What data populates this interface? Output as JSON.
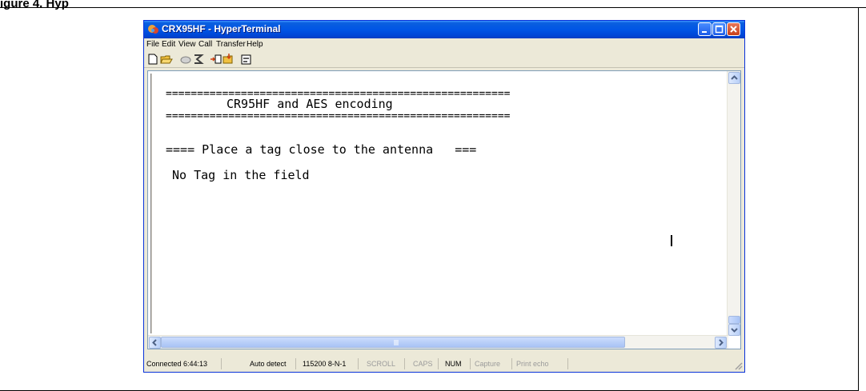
{
  "figure": {
    "caption": "igure 4. Hyp"
  },
  "window": {
    "title": "CRX95HF - HyperTerminal",
    "controls": {
      "minimize": "minimize-icon",
      "maximize": "maximize-icon",
      "close": "close-icon"
    }
  },
  "menu": [
    "File",
    "Edit",
    "View",
    "Call",
    "Transfer",
    "Help"
  ],
  "toolbar": [
    "new-connection-icon",
    "open-icon",
    "disconnect-icon",
    "dial-icon",
    "send-icon",
    "receive-icon",
    "properties-icon"
  ],
  "terminal": {
    "lines": [
      "=======================================================",
      "CR95HF and AES encoding",
      "=======================================================",
      "==== Place a tag close to the antenna   ===",
      "No Tag in the field"
    ]
  },
  "status": {
    "connected": "Connected 6:44:13",
    "detect": "Auto detect",
    "port": "115200 8-N-1",
    "scroll": "SCROLL",
    "caps": "CAPS",
    "num": "NUM",
    "capture": "Capture",
    "print_echo": "Print echo"
  },
  "colors": {
    "titlebar": "#0055e5",
    "close_button": "#c8401a",
    "chrome": "#ece9d8"
  }
}
